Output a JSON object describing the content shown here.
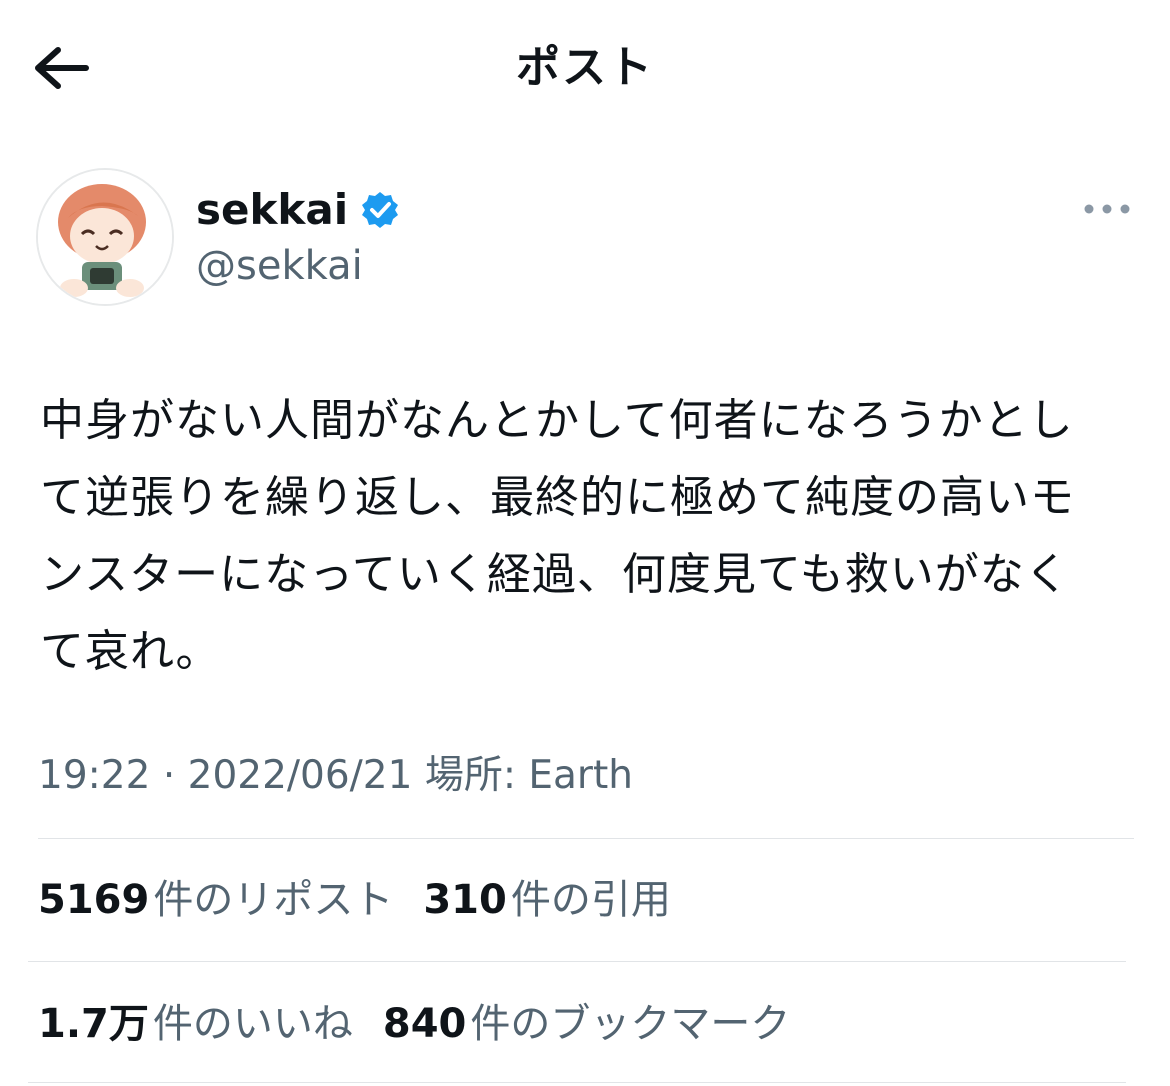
{
  "header": {
    "back_icon": "arrow-left-icon",
    "title": "ポスト"
  },
  "author": {
    "avatar_icon": "avatar-illustration",
    "display_name": "sekkai",
    "verified_icon": "verified-badge-icon",
    "verified_color": "#1d9bf0",
    "handle": "@sekkai",
    "more_icon": "more-dots-icon"
  },
  "tweet": {
    "text": "中身がない人間がなんとかして何者になろうかとし\nて逆張りを繰り返し、最終的に極めて純度の高いモ\nンスターになっていく経過、何度見ても救いがなく\nて哀れ。"
  },
  "meta": {
    "time": "19:22",
    "separator": "·",
    "date": "2022/06/21",
    "location_label": "場所:",
    "location": "Earth"
  },
  "stats": {
    "reposts_count": "5169",
    "reposts_label": "件のリポスト",
    "quotes_count": "310",
    "quotes_label": "件の引用",
    "likes_count": "1.7万",
    "likes_label": "件のいいね",
    "bookmarks_count": "840",
    "bookmarks_label": "件のブックマーク"
  },
  "colors": {
    "text": "#0f1419",
    "secondary": "#536471",
    "divider": "#e1e4e7"
  }
}
